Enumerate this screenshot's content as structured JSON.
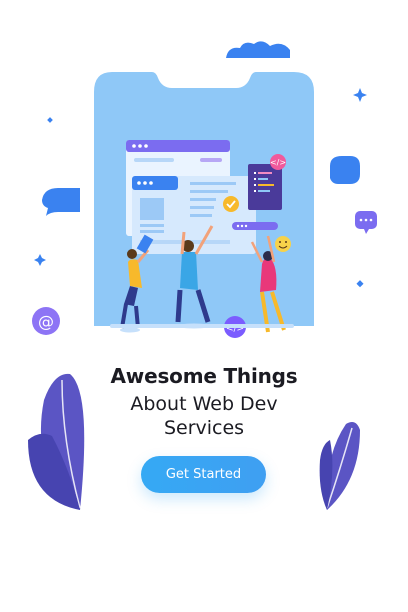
{
  "hero": {
    "title_bold": "Awesome Things",
    "title_line2": "About Web Dev",
    "title_line3": "Services"
  },
  "cta": {
    "label": "Get Started"
  },
  "icons": [
    "at-sign-icon",
    "chat-bubble-icon",
    "code-icon",
    "smiley-icon",
    "checkmark-icon",
    "sparkle-icon",
    "leaf-icon",
    "cloud-icon"
  ],
  "colors": {
    "accent": "#35a9f4",
    "phone": "#8fc8f7",
    "purple": "#7b5cff",
    "leaf": "#5b55c4",
    "text": "#1b1b22"
  }
}
